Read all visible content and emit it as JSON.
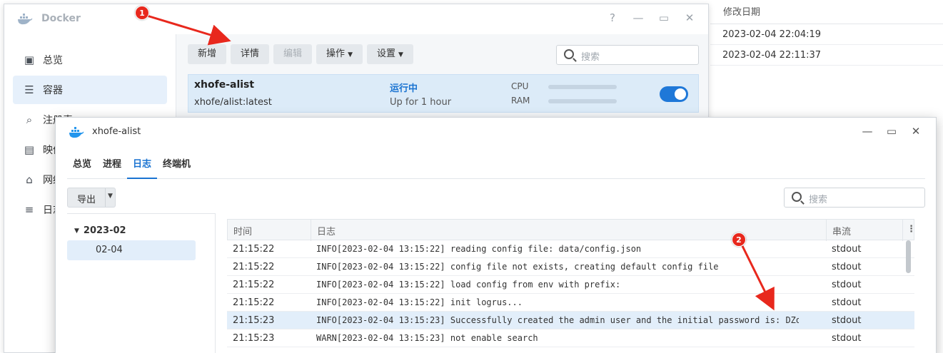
{
  "background_list": {
    "header": "修改日期",
    "rows": [
      "2023-02-04 22:04:19",
      "2023-02-04 22:11:37"
    ]
  },
  "docker_window": {
    "title": "Docker",
    "controls": {
      "help": "?",
      "minimize": "—",
      "maximize": "▭",
      "close": "✕"
    },
    "sidebar": [
      {
        "label": "总览",
        "icon": "overview-icon",
        "active": false
      },
      {
        "label": "容器",
        "icon": "container-icon",
        "active": true
      },
      {
        "label": "注册表",
        "icon": "registry-icon",
        "active": false
      },
      {
        "label": "映像",
        "icon": "image-icon",
        "active": false
      },
      {
        "label": "网络",
        "icon": "network-icon",
        "active": false
      },
      {
        "label": "日志",
        "icon": "log-icon",
        "active": false
      }
    ],
    "toolbar": {
      "add": "新增",
      "details": "详情",
      "edit": "编辑",
      "actions": "操作",
      "settings": "设置"
    },
    "search_placeholder": "搜索",
    "container": {
      "name": "xhofe-alist",
      "image": "xhofe/alist:latest",
      "status": "运行中",
      "uptime": "Up for 1 hour",
      "cpu_label": "CPU",
      "ram_label": "RAM",
      "enabled": true
    }
  },
  "detail_window": {
    "title": "xhofe-alist",
    "controls": {
      "minimize": "—",
      "maximize": "▭",
      "close": "✕"
    },
    "tabs": [
      {
        "label": "总览",
        "active": false
      },
      {
        "label": "进程",
        "active": false
      },
      {
        "label": "日志",
        "active": true
      },
      {
        "label": "终端机",
        "active": false
      }
    ],
    "export_label": "导出",
    "search_placeholder": "搜索",
    "date_tree": {
      "month": "2023-02",
      "day": "02-04"
    },
    "log_columns": {
      "time": "时间",
      "log": "日志",
      "stream": "串流"
    },
    "logs": [
      {
        "time": "21:15:22",
        "msg": "INFO[2023-02-04 13:15:22] reading config file: data/config.json",
        "stream": "stdout"
      },
      {
        "time": "21:15:22",
        "msg": "INFO[2023-02-04 13:15:22] config file not exists, creating default config file",
        "stream": "stdout"
      },
      {
        "time": "21:15:22",
        "msg": "INFO[2023-02-04 13:15:22] load config from env with prefix:",
        "stream": "stdout"
      },
      {
        "time": "21:15:22",
        "msg": "INFO[2023-02-04 13:15:22] init logrus...",
        "stream": "stdout"
      },
      {
        "time": "21:15:23",
        "msg": "INFO[2023-02-04 13:15:23] Successfully created the admin user and the initial password is: DZofEe",
        "stream": "stdout"
      },
      {
        "time": "21:15:23",
        "msg": "WARN[2023-02-04 13:15:23] not enable search",
        "stream": "stdout"
      }
    ]
  },
  "annotations": [
    {
      "label": "1"
    },
    {
      "label": "2"
    }
  ],
  "colors": {
    "accent": "#1a73d1",
    "annotation": "#e8281d",
    "selected_bg": "#e2eefa"
  }
}
